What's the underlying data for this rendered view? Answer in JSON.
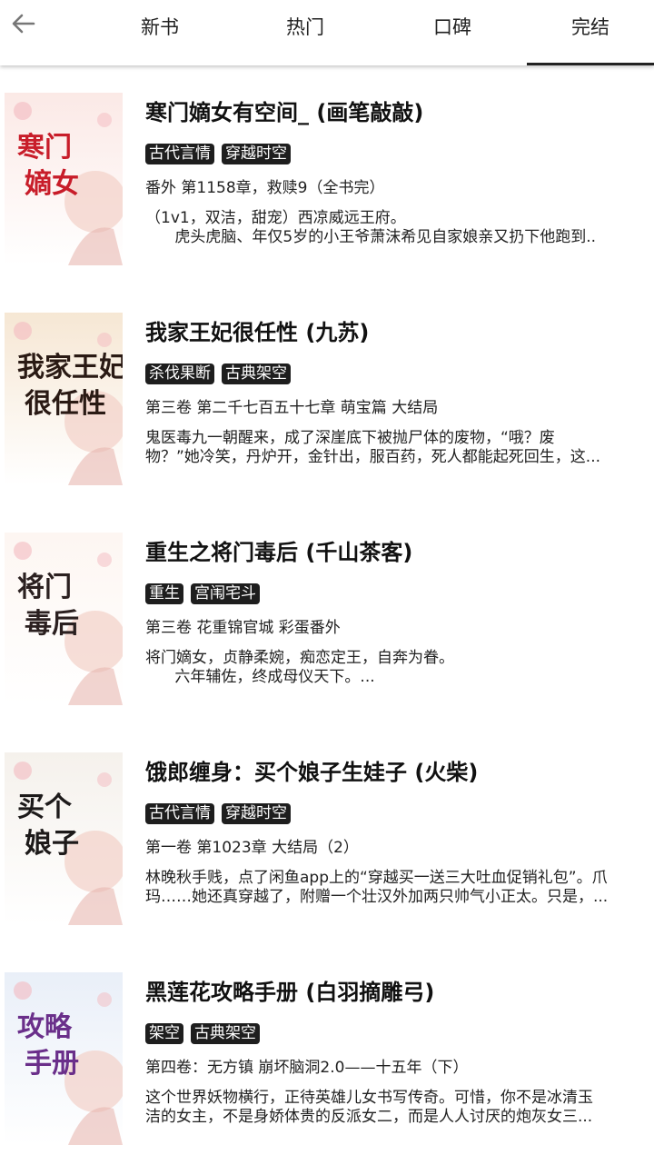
{
  "header": {
    "back_icon": "arrow-left-icon",
    "tabs": [
      {
        "label": "新书"
      },
      {
        "label": "热门"
      },
      {
        "label": "口碑"
      },
      {
        "label": "完结"
      }
    ],
    "active_tab": "完结"
  },
  "books": [
    {
      "title": "寒门嫡女有空间_ (画笔敲敲)",
      "tags": [
        "古代言情",
        "穿越时空"
      ],
      "chapter": "番外 第1158章，救赎9（全书完）",
      "desc": "（1v1，双洁，甜宠）西凉威远王府。\n      虎头虎脑、年仅5岁的小王爷萧沫希见自家娘亲又扔下他跑到..",
      "cover_text": [
        "寒门",
        "嫡女"
      ],
      "cover_colors": [
        "#fbe9e6",
        "#c81d2a"
      ]
    },
    {
      "title": "我家王妃很任性 (九苏)",
      "tags": [
        "杀伐果断",
        "古典架空"
      ],
      "chapter": "第三卷 第二千七百五十七章 萌宝篇 大结局",
      "desc": "鬼医毒九一朝醒来，成了深崖底下被抛尸体的废物，“哦？废\n物？”她冷笑，丹炉开，金针出，服百药，死人都能起死回生，这...",
      "cover_text": [
        "我家王妃",
        "很任性"
      ],
      "cover_colors": [
        "#f6e7d4",
        "#2a1a14"
      ]
    },
    {
      "title": "重生之将门毒后 (千山茶客)",
      "tags": [
        "重生",
        "宫闱宅斗"
      ],
      "chapter": "第三卷  花重锦官城 彩蛋番外",
      "desc": "将门嫡女，贞静柔婉，痴恋定王，自奔为眷。\n      六年辅佐，终成母仪天下。...",
      "cover_text": [
        "将门",
        "毒后"
      ],
      "cover_colors": [
        "#fdf6f2",
        "#2b2020"
      ]
    },
    {
      "title": "饿郎缠身：买个娘子生娃子 (火柴)",
      "tags": [
        "古代言情",
        "穿越时空"
      ],
      "chapter": "第一卷 第1023章 大结局（2）",
      "desc": "林晚秋手贱，点了闲鱼app上的“穿越买一送三大吐血促销礼包”。爪\n玛……她还真穿越了，附赠一个壮汉外加两只帅气小正太。只是，...",
      "cover_text": [
        "买个",
        "娘子"
      ],
      "cover_colors": [
        "#f5f1ec",
        "#1d1a1a"
      ]
    },
    {
      "title": "黑莲花攻略手册 (白羽摘雕弓)",
      "tags": [
        "架空",
        "古典架空"
      ],
      "chapter": "第四卷：无方镇 崩坏脑洞2.0——十五年（下）",
      "desc": "这个世界妖物横行，正待英雄儿女书写传奇。可惜，你不是冰清玉\n洁的女主，不是身娇体贵的反派女二，而是人人讨厌的炮灰女三...",
      "cover_text": [
        "攻略",
        "手册"
      ],
      "cover_colors": [
        "#e9eff8",
        "#6a2f8a"
      ]
    }
  ]
}
